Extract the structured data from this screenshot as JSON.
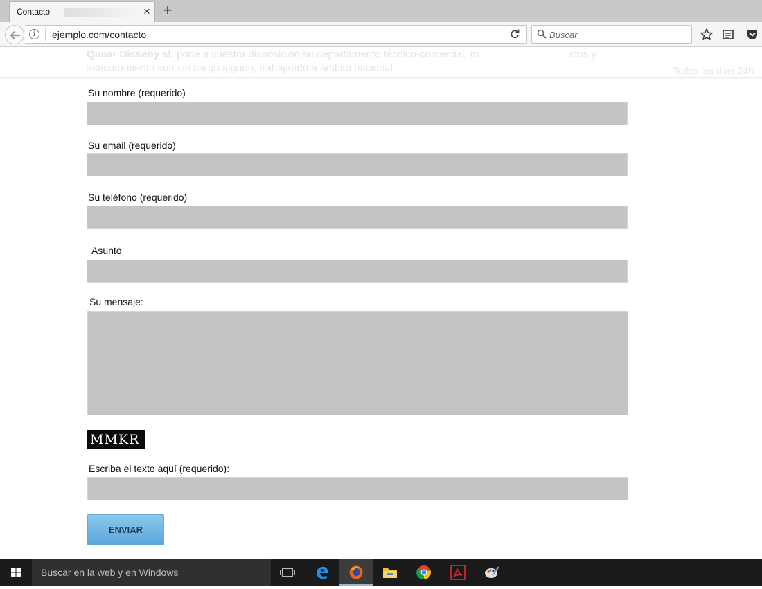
{
  "browser": {
    "tab_title": "Contacto",
    "new_tab_symbol": "+",
    "close_symbol": "×",
    "url": "ejemplo.com/contacto",
    "search_placeholder": "Buscar"
  },
  "page_background_text": {
    "line1_bold": "Quear Disseny sl.",
    "line1_rest": " pone a vuestra disposición su departamento técnico-comercial, m",
    "line1_right": "stos y",
    "line2": "asesoramiento son sin cargo alguno, trabajando a ámbito nacional",
    "hours": "Todos los días 24h"
  },
  "form": {
    "name_label": "Su nombre (requerido)",
    "email_label": "Su email (requerido)",
    "phone_label": "Su teléfono (requerido)",
    "subject_label": "Asunto",
    "message_label": "Su mensaje:",
    "captcha_text": "MMKR",
    "captcha_label": "Escriba el texto aquí (requerido):",
    "submit_label": "ENVIAR",
    "field_color": "#c4c4c4",
    "button_color": "#6fb6e4"
  },
  "taskbar": {
    "search_text": "Buscar en la web y en Windows",
    "apps": [
      "task-view",
      "edge",
      "firefox",
      "file-explorer",
      "chrome",
      "acrobat",
      "paint"
    ]
  }
}
